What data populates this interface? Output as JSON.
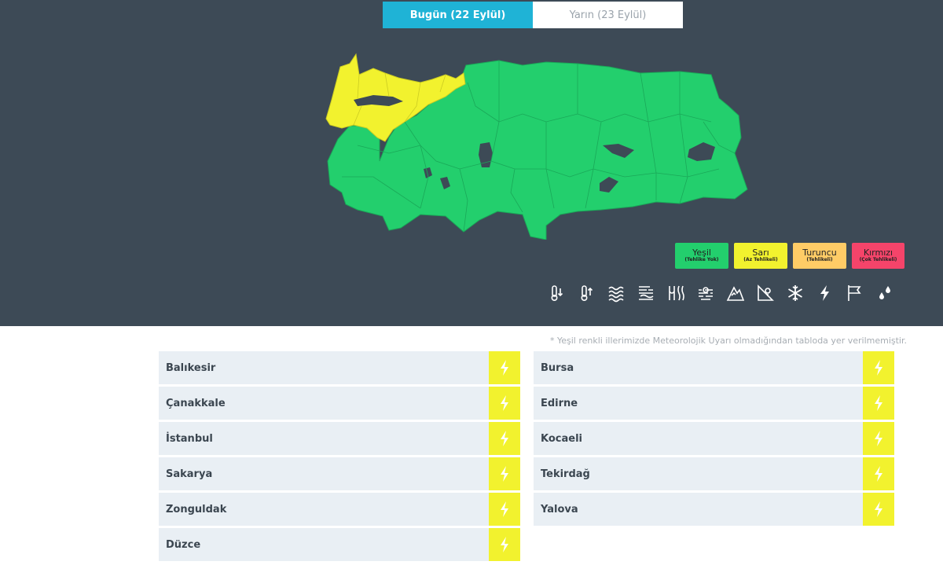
{
  "tabs": [
    {
      "label": "Bugün (22 Eylül)",
      "active": true
    },
    {
      "label": "Yarın (23 Eylül)",
      "active": false
    }
  ],
  "legend": [
    {
      "name": "Yeşil",
      "sub": "(Tehlike Yok)",
      "color": "#23cf6d"
    },
    {
      "name": "Sarı",
      "sub": "(Az Tehlikeli)",
      "color": "#f2f22e"
    },
    {
      "name": "Turuncu",
      "sub": "(Tehlikeli)",
      "color": "#ffcc66"
    },
    {
      "name": "Kırmızı",
      "sub": "(Çok Tehlikeli)",
      "color": "#f5446a"
    }
  ],
  "hazard_icons": [
    "low-temperature-icon",
    "high-temperature-icon",
    "wave-icon",
    "sandstorm-icon",
    "hot-weather-icon",
    "fog-icon",
    "avalanche-icon",
    "snow-melt-icon",
    "snowflake-icon",
    "lightning-icon",
    "wind-icon",
    "rain-icon"
  ],
  "note": "* Yeşil renkli illerimizde Meteorolojik Uyarı olmadığından tabloda yer verilmemiştir.",
  "provinces_left": [
    "Balıkesir",
    "Çanakkale",
    "İstanbul",
    "Sakarya",
    "Zonguldak",
    "Düzce"
  ],
  "provinces_right": [
    "Bursa",
    "Edirne",
    "Kocaeli",
    "Tekirdağ",
    "Yalova"
  ],
  "warning_icon": "lightning-icon",
  "colors": {
    "panel": "#3d4a56",
    "accent": "#1fb3d6",
    "green": "#23cf6d",
    "yellow": "#f2f22e",
    "row_bg": "#e9eff4"
  }
}
